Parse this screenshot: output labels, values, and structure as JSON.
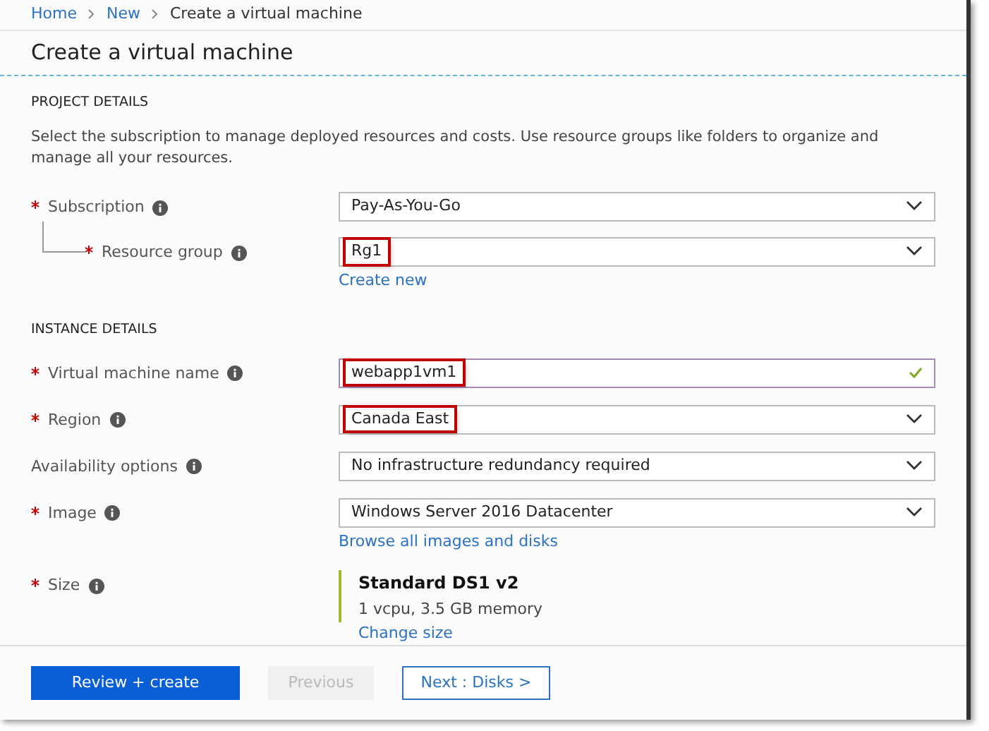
{
  "breadcrumb": [
    {
      "label": "Home",
      "link": true
    },
    {
      "label": "New",
      "link": true
    },
    {
      "label": "Create a virtual machine",
      "link": false
    }
  ],
  "title": "Create a virtual machine",
  "project_details": {
    "heading": "PROJECT DETAILS",
    "description": "Select the subscription to manage deployed resources and costs. Use resource groups like folders to organize and manage all your resources.",
    "fields": [
      {
        "label": "Subscription",
        "required": true,
        "nested": false,
        "kind": "dropdown",
        "value": "Pay-As-You-Go",
        "highlighted": false
      },
      {
        "label": "Resource group",
        "required": true,
        "nested": true,
        "kind": "dropdown",
        "value": "Rg1",
        "highlighted": true,
        "link": "Create new"
      }
    ]
  },
  "instance_details": {
    "heading": "INSTANCE DETAILS",
    "fields": [
      {
        "label": "Virtual machine name",
        "required": true,
        "nested": false,
        "kind": "text",
        "value": "webapp1vm1",
        "highlighted": true,
        "valid": true
      },
      {
        "label": "Region",
        "required": true,
        "nested": false,
        "kind": "dropdown",
        "value": "Canada East",
        "highlighted": true
      },
      {
        "label": "Availability options",
        "required": false,
        "nested": false,
        "kind": "dropdown",
        "value": "No infrastructure redundancy required",
        "highlighted": false
      },
      {
        "label": "Image",
        "required": true,
        "nested": false,
        "kind": "dropdown",
        "value": "Windows Server 2016 Datacenter",
        "highlighted": false,
        "link": "Browse all images and disks"
      },
      {
        "label": "Size",
        "required": true,
        "nested": false,
        "kind": "size",
        "value": "Standard DS1 v2",
        "detail": "1 vcpu, 3.5 GB memory",
        "highlighted": false,
        "link": "Change size"
      }
    ]
  },
  "buttons": [
    {
      "label": "Review + create",
      "kind": "primary",
      "disabled": false
    },
    {
      "label": "Previous",
      "kind": "secondary",
      "disabled": true
    },
    {
      "label": "Next : Disks >",
      "kind": "outline",
      "disabled": false
    }
  ]
}
